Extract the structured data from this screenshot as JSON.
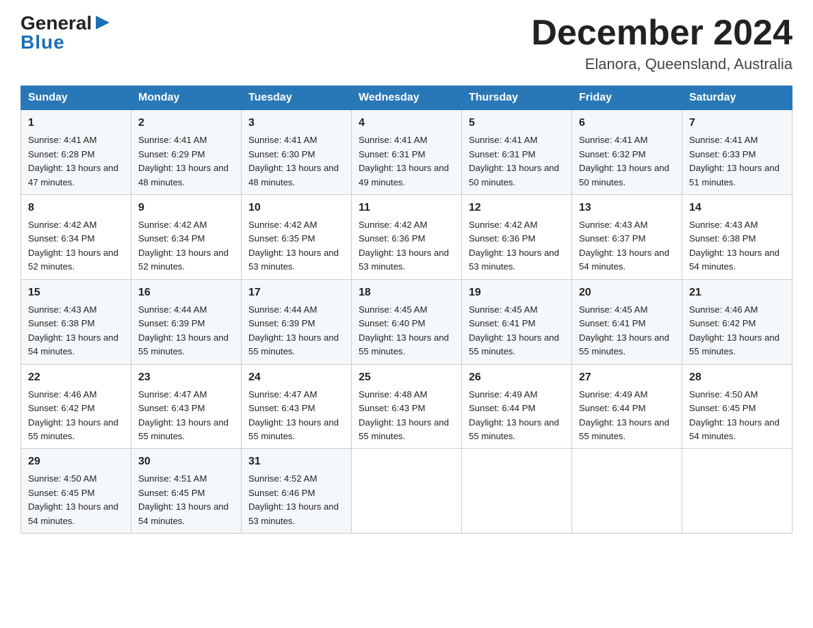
{
  "header": {
    "logo_general": "General",
    "logo_blue": "Blue",
    "month_title": "December 2024",
    "location": "Elanora, Queensland, Australia"
  },
  "days_of_week": [
    "Sunday",
    "Monday",
    "Tuesday",
    "Wednesday",
    "Thursday",
    "Friday",
    "Saturday"
  ],
  "weeks": [
    [
      {
        "day": "1",
        "sunrise": "4:41 AM",
        "sunset": "6:28 PM",
        "daylight": "13 hours and 47 minutes."
      },
      {
        "day": "2",
        "sunrise": "4:41 AM",
        "sunset": "6:29 PM",
        "daylight": "13 hours and 48 minutes."
      },
      {
        "day": "3",
        "sunrise": "4:41 AM",
        "sunset": "6:30 PM",
        "daylight": "13 hours and 48 minutes."
      },
      {
        "day": "4",
        "sunrise": "4:41 AM",
        "sunset": "6:31 PM",
        "daylight": "13 hours and 49 minutes."
      },
      {
        "day": "5",
        "sunrise": "4:41 AM",
        "sunset": "6:31 PM",
        "daylight": "13 hours and 50 minutes."
      },
      {
        "day": "6",
        "sunrise": "4:41 AM",
        "sunset": "6:32 PM",
        "daylight": "13 hours and 50 minutes."
      },
      {
        "day": "7",
        "sunrise": "4:41 AM",
        "sunset": "6:33 PM",
        "daylight": "13 hours and 51 minutes."
      }
    ],
    [
      {
        "day": "8",
        "sunrise": "4:42 AM",
        "sunset": "6:34 PM",
        "daylight": "13 hours and 52 minutes."
      },
      {
        "day": "9",
        "sunrise": "4:42 AM",
        "sunset": "6:34 PM",
        "daylight": "13 hours and 52 minutes."
      },
      {
        "day": "10",
        "sunrise": "4:42 AM",
        "sunset": "6:35 PM",
        "daylight": "13 hours and 53 minutes."
      },
      {
        "day": "11",
        "sunrise": "4:42 AM",
        "sunset": "6:36 PM",
        "daylight": "13 hours and 53 minutes."
      },
      {
        "day": "12",
        "sunrise": "4:42 AM",
        "sunset": "6:36 PM",
        "daylight": "13 hours and 53 minutes."
      },
      {
        "day": "13",
        "sunrise": "4:43 AM",
        "sunset": "6:37 PM",
        "daylight": "13 hours and 54 minutes."
      },
      {
        "day": "14",
        "sunrise": "4:43 AM",
        "sunset": "6:38 PM",
        "daylight": "13 hours and 54 minutes."
      }
    ],
    [
      {
        "day": "15",
        "sunrise": "4:43 AM",
        "sunset": "6:38 PM",
        "daylight": "13 hours and 54 minutes."
      },
      {
        "day": "16",
        "sunrise": "4:44 AM",
        "sunset": "6:39 PM",
        "daylight": "13 hours and 55 minutes."
      },
      {
        "day": "17",
        "sunrise": "4:44 AM",
        "sunset": "6:39 PM",
        "daylight": "13 hours and 55 minutes."
      },
      {
        "day": "18",
        "sunrise": "4:45 AM",
        "sunset": "6:40 PM",
        "daylight": "13 hours and 55 minutes."
      },
      {
        "day": "19",
        "sunrise": "4:45 AM",
        "sunset": "6:41 PM",
        "daylight": "13 hours and 55 minutes."
      },
      {
        "day": "20",
        "sunrise": "4:45 AM",
        "sunset": "6:41 PM",
        "daylight": "13 hours and 55 minutes."
      },
      {
        "day": "21",
        "sunrise": "4:46 AM",
        "sunset": "6:42 PM",
        "daylight": "13 hours and 55 minutes."
      }
    ],
    [
      {
        "day": "22",
        "sunrise": "4:46 AM",
        "sunset": "6:42 PM",
        "daylight": "13 hours and 55 minutes."
      },
      {
        "day": "23",
        "sunrise": "4:47 AM",
        "sunset": "6:43 PM",
        "daylight": "13 hours and 55 minutes."
      },
      {
        "day": "24",
        "sunrise": "4:47 AM",
        "sunset": "6:43 PM",
        "daylight": "13 hours and 55 minutes."
      },
      {
        "day": "25",
        "sunrise": "4:48 AM",
        "sunset": "6:43 PM",
        "daylight": "13 hours and 55 minutes."
      },
      {
        "day": "26",
        "sunrise": "4:49 AM",
        "sunset": "6:44 PM",
        "daylight": "13 hours and 55 minutes."
      },
      {
        "day": "27",
        "sunrise": "4:49 AM",
        "sunset": "6:44 PM",
        "daylight": "13 hours and 55 minutes."
      },
      {
        "day": "28",
        "sunrise": "4:50 AM",
        "sunset": "6:45 PM",
        "daylight": "13 hours and 54 minutes."
      }
    ],
    [
      {
        "day": "29",
        "sunrise": "4:50 AM",
        "sunset": "6:45 PM",
        "daylight": "13 hours and 54 minutes."
      },
      {
        "day": "30",
        "sunrise": "4:51 AM",
        "sunset": "6:45 PM",
        "daylight": "13 hours and 54 minutes."
      },
      {
        "day": "31",
        "sunrise": "4:52 AM",
        "sunset": "6:46 PM",
        "daylight": "13 hours and 53 minutes."
      },
      null,
      null,
      null,
      null
    ]
  ]
}
